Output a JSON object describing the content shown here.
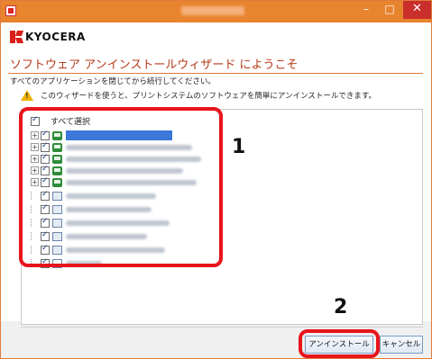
{
  "window": {
    "close_glyph": "✕",
    "minimize_glyph": "–",
    "maximize_glyph": "□"
  },
  "header": {
    "logo_text": "KYOCERA"
  },
  "wizard": {
    "heading": "ソフトウェア アンインストールウィザード にようこそ",
    "instruction": "すべてのアプリケーションを閉じてから続行してください。",
    "info": "このウィザードを使うと、プリントシステムのソフトウェアを簡単にアンインストールできます。"
  },
  "tree": {
    "select_all_label": "すべて選択",
    "items": [
      {
        "kind": "expandable",
        "icon": "printer-icon"
      },
      {
        "kind": "expandable",
        "icon": "printer-icon"
      },
      {
        "kind": "expandable",
        "icon": "printer-icon"
      },
      {
        "kind": "expandable",
        "icon": "printer-icon"
      },
      {
        "kind": "expandable",
        "icon": "printer-icon"
      },
      {
        "kind": "leaf",
        "icon": "module-icon"
      },
      {
        "kind": "leaf",
        "icon": "module-icon"
      },
      {
        "kind": "leaf",
        "icon": "module-icon"
      },
      {
        "kind": "leaf",
        "icon": "module-icon"
      },
      {
        "kind": "leaf",
        "icon": "module-icon"
      },
      {
        "kind": "leaf",
        "icon": "document-icon"
      }
    ]
  },
  "callouts": {
    "one": "1",
    "two": "2"
  },
  "buttons": {
    "uninstall": "アンインストール",
    "cancel": "キャンセル"
  },
  "colors": {
    "titlebar": "#e8832e",
    "accent_heading": "#b83a1a",
    "callout": "#e8141b",
    "selection": "#3b78d9"
  }
}
